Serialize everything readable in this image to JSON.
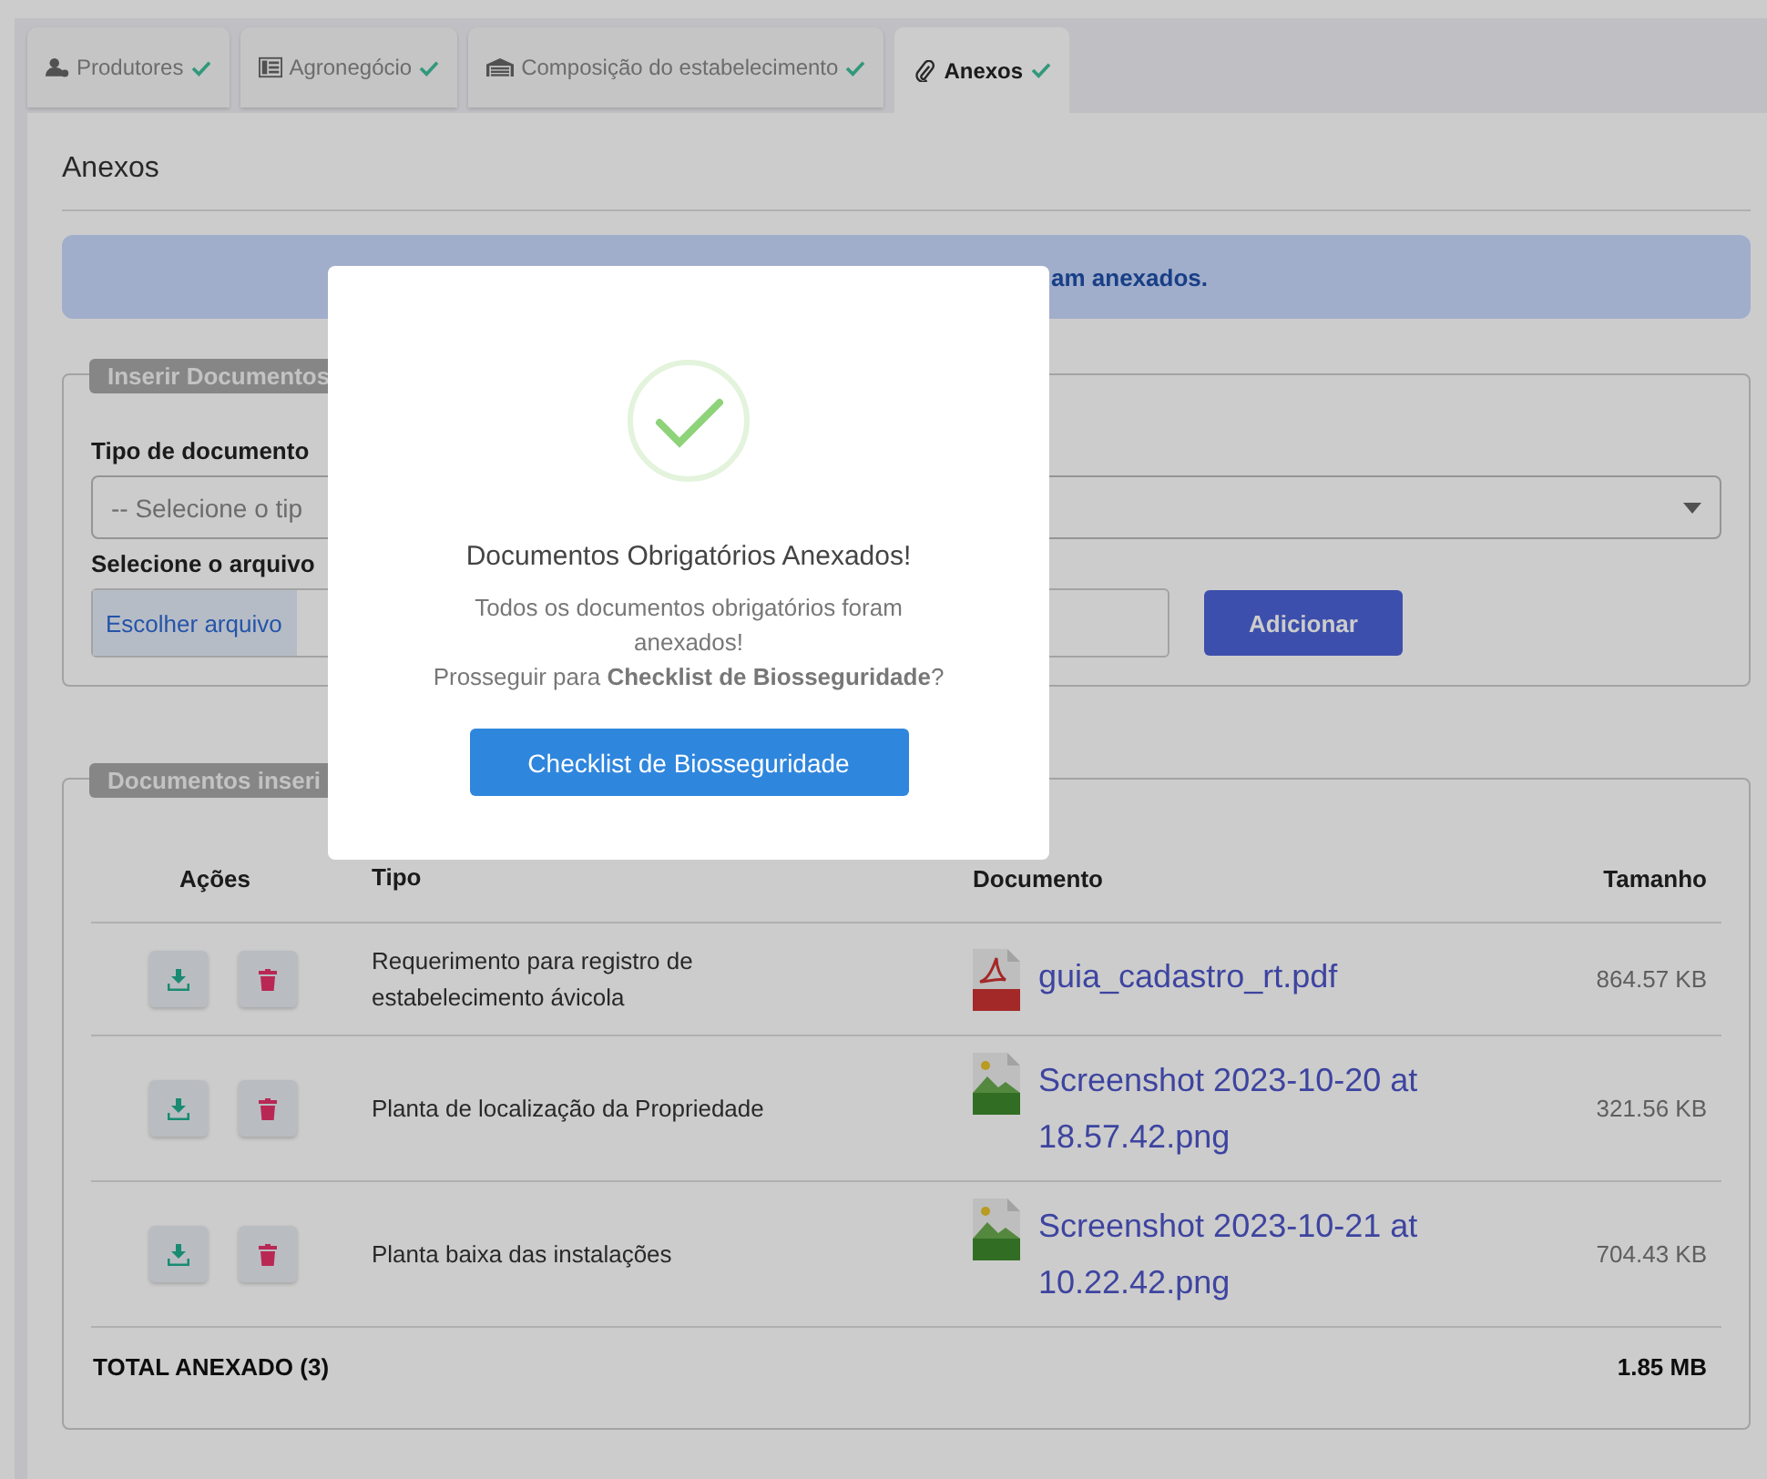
{
  "tabs": [
    {
      "label": "Produtores",
      "done": true,
      "selected": false
    },
    {
      "label": "Agronegócio",
      "done": true,
      "selected": false
    },
    {
      "label": "Composição do estabelecimento",
      "done": true,
      "selected": false
    },
    {
      "label": "Anexos",
      "done": true,
      "selected": true
    }
  ],
  "heading": "Anexos",
  "alert": "am anexados.",
  "insert_section": {
    "legend": "Inserir Documentos",
    "type_label": "Tipo de documento",
    "type_placeholder": "-- Selecione o tip",
    "file_label": "Selecione o arquivo",
    "file_button": "Escolher arquivo",
    "add_button": "Adicionar"
  },
  "documents_section": {
    "legend": "Documentos inseri",
    "columns": [
      "Ações",
      "Tipo",
      "Documento",
      "Tamanho"
    ],
    "rows": [
      {
        "type": "Requerimento para registro de estabelecimento ávicola",
        "kind": "pdf",
        "document": "guia_cadastro_rt.pdf",
        "size": "864.57 KB"
      },
      {
        "type": "Planta de localização da Propriedade",
        "kind": "png",
        "document": "Screenshot 2023-10-20 at 18.57.42.png",
        "size": "321.56 KB"
      },
      {
        "type": "Planta baixa das instalações",
        "kind": "png",
        "document": "Screenshot 2023-10-21 at 10.22.42.png",
        "size": "704.43 KB"
      }
    ],
    "total_label": "TOTAL ANEXADO (3)",
    "total_value": "1.85 MB"
  },
  "dialog": {
    "title": "Documentos Obrigatórios Anexados!",
    "message": "Todos os documentos obrigatórios foram anexados!",
    "question": "Prosseguir para **Checklist de Biosseguridade**?",
    "button": "Checklist de Biosseguridade"
  }
}
